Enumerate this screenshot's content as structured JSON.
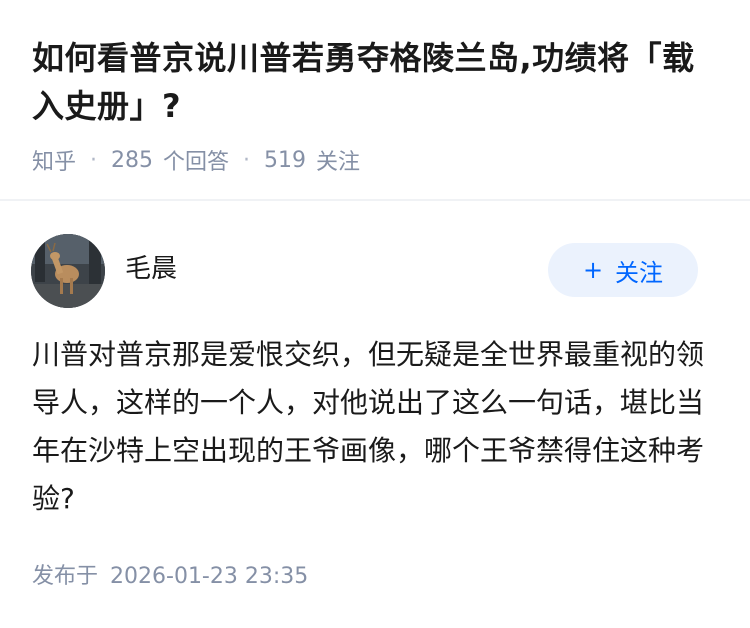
{
  "question": {
    "title": "如何看普京说川普若勇夺格陵兰岛,功绩将「载入史册」?",
    "source": "知乎",
    "separator": "·",
    "answers_count": "285",
    "answers_label": "个回答",
    "follows_count": "519",
    "follows_label": "关注"
  },
  "answer": {
    "author_name": "毛晨",
    "follow_button_icon": "+",
    "follow_button_label": "关注",
    "content": "川普对普京那是爱恨交织，但无疑是全世界最重视的领导人，这样的一个人，对他说出了这么一句话，堪比当年在沙特上空出现的王爷画像，哪个王爷禁得住这种考验?",
    "publish_label": "发布于",
    "publish_time": "2026-01-23 23:35"
  },
  "colors": {
    "accent": "#0066ff",
    "follow_bg": "#ebf2fd",
    "meta_gray": "#8590a6",
    "text": "#1a1a1a"
  },
  "icons": {
    "avatar": "deer-photo-avatar",
    "follow": "plus-icon"
  }
}
